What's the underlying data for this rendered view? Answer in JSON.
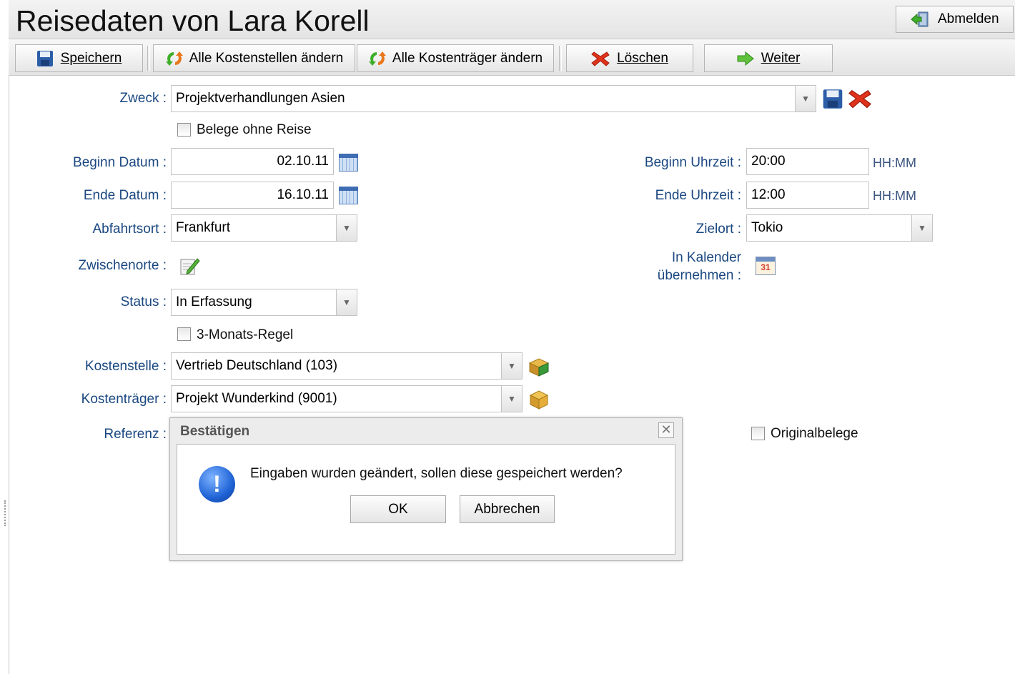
{
  "header": {
    "title": "Reisedaten von Lara Korell",
    "logout_label": "Abmelden"
  },
  "toolbar": {
    "save_label": "Speichern",
    "change_cost_centers_label": "Alle Kostenstellen ändern",
    "change_cost_units_label": "Alle Kostenträger ändern",
    "delete_label": "Löschen",
    "next_label": "Weiter"
  },
  "form": {
    "purpose": {
      "label": "Zweck :",
      "value": "Projektverhandlungen Asien"
    },
    "receipts_without_trip": {
      "label": "Belege ohne Reise",
      "checked": false
    },
    "start_date": {
      "label": "Beginn Datum :",
      "value": "02.10.11"
    },
    "end_date": {
      "label": "Ende Datum :",
      "value": "16.10.11"
    },
    "start_time": {
      "label": "Beginn Uhrzeit :",
      "value": "20:00",
      "hint": "HH:MM"
    },
    "end_time": {
      "label": "Ende Uhrzeit :",
      "value": "12:00",
      "hint": "HH:MM"
    },
    "departure": {
      "label": "Abfahrtsort :",
      "value": "Frankfurt"
    },
    "destination": {
      "label": "Zielort :",
      "value": "Tokio"
    },
    "stopovers": {
      "label": "Zwischenorte :"
    },
    "calendar": {
      "label_line1": "In Kalender",
      "label_line2": "übernehmen :",
      "icon_text": "31"
    },
    "status": {
      "label": "Status :",
      "value": "In Erfassung"
    },
    "three_month_rule": {
      "label": "3-Monats-Regel",
      "checked": false
    },
    "cost_center": {
      "label": "Kostenstelle :",
      "value": "Vertrieb Deutschland (103)"
    },
    "cost_unit": {
      "label": "Kostenträger :",
      "value": "Projekt Wunderkind (9001)"
    },
    "reference": {
      "label": "Referenz :"
    },
    "original_receipts": {
      "label": "Originalbelege",
      "checked": false
    }
  },
  "dialog": {
    "title": "Bestätigen",
    "close_glyph": "✕",
    "icon_glyph": "!",
    "message": "Eingaben wurden geändert, sollen diese gespeichert werden?",
    "ok_label": "OK",
    "cancel_label": "Abbrechen"
  },
  "colors": {
    "label_blue": "#1a4780",
    "delete_red": "#e0331b",
    "next_green": "#3fae2a",
    "save_blue": "#2c5ea8"
  }
}
